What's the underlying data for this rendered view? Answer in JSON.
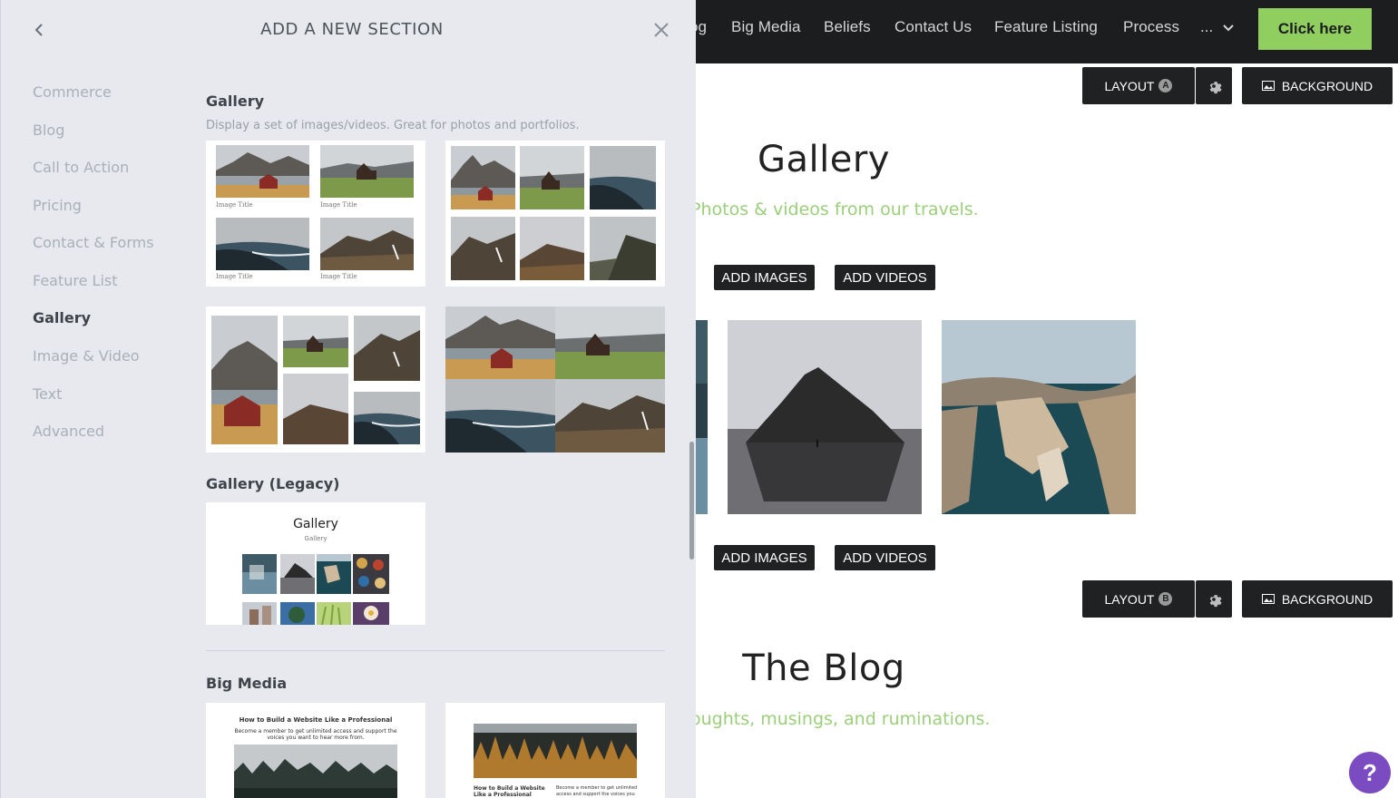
{
  "panel": {
    "title": "ADD A NEW SECTION",
    "categories": [
      "Commerce",
      "Blog",
      "Call to Action",
      "Pricing",
      "Contact & Forms",
      "Feature List",
      "Gallery",
      "Image & Video",
      "Text",
      "Advanced"
    ],
    "active_category": "Gallery",
    "groups": {
      "gallery": {
        "title": "Gallery",
        "description": "Display a set of images/videos. Great for photos and portfolios.",
        "caption": "Image Title"
      },
      "gallery_legacy": {
        "title": "Gallery (Legacy)",
        "preview_title": "Gallery",
        "preview_subtitle": "Gallery"
      },
      "big_media": {
        "title": "Big Media",
        "preview_heading": "How to Build a Website Like a Professional",
        "preview_body": "Become a member to get unlimited access and support the voices you want to hear more from.",
        "preview_heading_2": "How to Build a Website Like a Professional",
        "preview_body_2": "Become a member to get unlimited access and support the voices you want to hear more from."
      }
    }
  },
  "site": {
    "nav": [
      "og",
      "Big Media",
      "Beliefs",
      "Contact Us",
      "Feature Listing",
      "Process"
    ],
    "nav_more": "...",
    "cta_label": "Click here",
    "toolbar_a": {
      "layout_label": "LAYOUT",
      "badge": "A",
      "background_label": "BACKGROUND"
    },
    "toolbar_b": {
      "layout_label": "LAYOUT",
      "badge": "B",
      "background_label": "BACKGROUND"
    },
    "gallery_title": "Gallery",
    "gallery_subtitle": "Photos & videos from our travels.",
    "add_images": "ADD IMAGES",
    "add_videos": "ADD VIDEOS",
    "blog_title": "The Blog",
    "blog_subtitle": "oughts, musings, and ruminations.",
    "help_label": "?"
  },
  "colors": {
    "accent_green": "#8fce5f",
    "subtitle_green": "#9bcf7b",
    "nav_dark": "#1b1d1e",
    "panel_bg": "#e7e9ee",
    "help_purple": "#7b4bc1"
  }
}
